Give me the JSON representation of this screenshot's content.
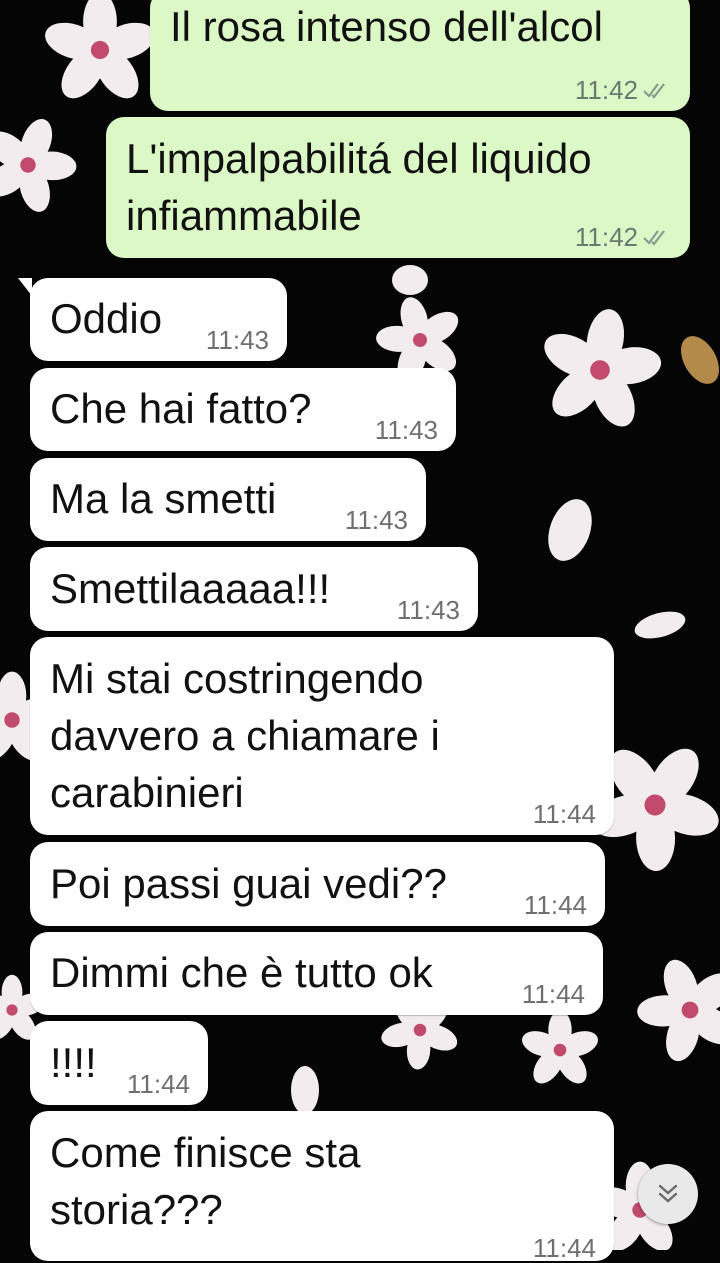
{
  "messages": [
    {
      "text": "Il rosa intenso dell'alcol",
      "time": "11:42",
      "direction": "out",
      "read": true
    },
    {
      "text": "L'impalpabilitá del liquido\ninfiammabile",
      "time": "11:42",
      "direction": "out",
      "read": true
    },
    {
      "text": "Oddio",
      "time": "11:43",
      "direction": "in"
    },
    {
      "text": "Che hai fatto?",
      "time": "11:43",
      "direction": "in"
    },
    {
      "text": "Ma la smetti",
      "time": "11:43",
      "direction": "in"
    },
    {
      "text": "Smettilaaaaa!!!",
      "time": "11:43",
      "direction": "in"
    },
    {
      "text": "Mi stai costringendo\ndavvero a chiamare i\ncarabinieri",
      "time": "11:44",
      "direction": "in"
    },
    {
      "text": "Poi passi guai vedi??",
      "time": "11:44",
      "direction": "in"
    },
    {
      "text": "Dimmi che è tutto ok",
      "time": "11:44",
      "direction": "in"
    },
    {
      "text": "!!!!",
      "time": "11:44",
      "direction": "in"
    },
    {
      "text": "Come finisce sta\nstoria???",
      "time": "11:44",
      "direction": "in"
    }
  ],
  "icons": {
    "read_receipt": "double-check-icon",
    "scroll_down": "double-chevron-down-icon"
  },
  "colors": {
    "outgoing_bubble": "#dcf8c6",
    "incoming_bubble": "#ffffff",
    "read_ticks": "#8a9a90",
    "wallpaper": "#050505"
  }
}
